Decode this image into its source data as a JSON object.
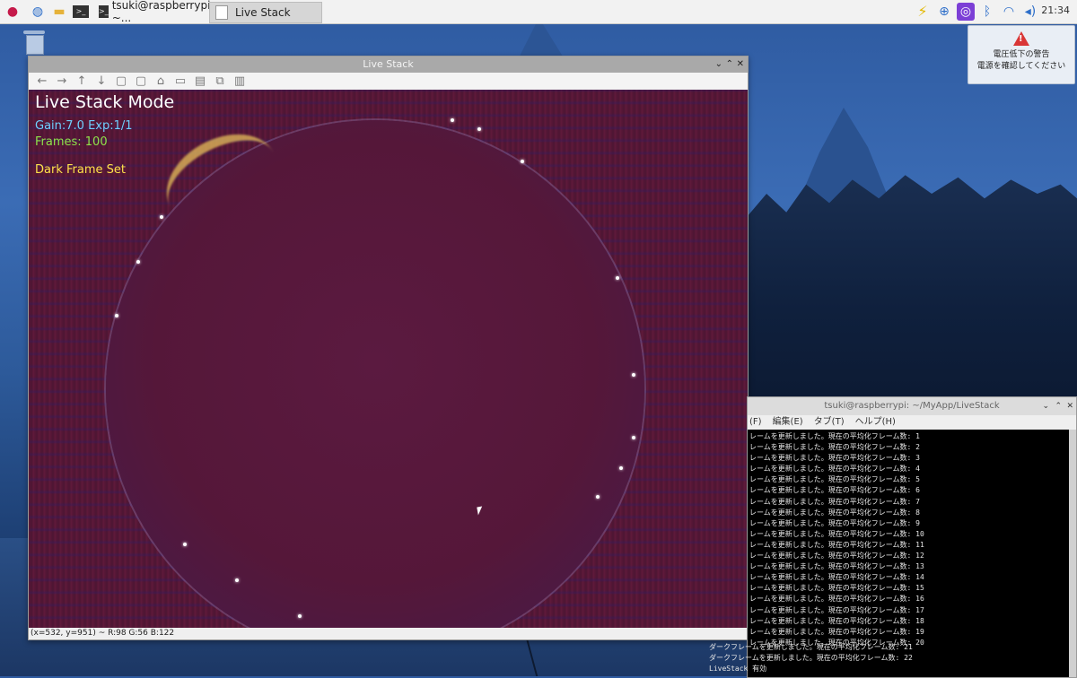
{
  "taskbar": {
    "tasks": [
      {
        "label": "tsuki@raspberrypi: ~..."
      },
      {
        "label": "Live Stack"
      }
    ],
    "clock": "21:34",
    "icons": [
      "raspberry-menu-icon",
      "browser-globe-icon",
      "file-manager-icon",
      "terminal-icon",
      "power-bolt-icon",
      "download-icon",
      "vnc-icon",
      "bluetooth-icon",
      "wifi-icon",
      "volume-icon"
    ]
  },
  "notification": {
    "line1": "電圧低下の警告",
    "line2": "電源を確認してください"
  },
  "livestack": {
    "window_title": "Live Stack",
    "overlay": {
      "mode": "Live Stack Mode",
      "gain_exp": "Gain:7.0 Exp:1/1",
      "frames": "Frames: 100",
      "dark": "Dark Frame Set"
    },
    "status": "(x=532, y=951) ~ R:98 G:56 B:122"
  },
  "terminal": {
    "title": "tsuki@raspberrypi: ~/MyApp/LiveStack",
    "menu": [
      "(F)",
      "編集(E)",
      "タブ(T)",
      "ヘルプ(H)"
    ],
    "lines": [
      "レームを更新しました。現在の平均化フレーム数: 1",
      "レームを更新しました。現在の平均化フレーム数: 2",
      "レームを更新しました。現在の平均化フレーム数: 3",
      "レームを更新しました。現在の平均化フレーム数: 4",
      "レームを更新しました。現在の平均化フレーム数: 5",
      "レームを更新しました。現在の平均化フレーム数: 6",
      "レームを更新しました。現在の平均化フレーム数: 7",
      "レームを更新しました。現在の平均化フレーム数: 8",
      "レームを更新しました。現在の平均化フレーム数: 9",
      "レームを更新しました。現在の平均化フレーム数: 10",
      "レームを更新しました。現在の平均化フレーム数: 11",
      "レームを更新しました。現在の平均化フレーム数: 12",
      "レームを更新しました。現在の平均化フレーム数: 13",
      "レームを更新しました。現在の平均化フレーム数: 14",
      "レームを更新しました。現在の平均化フレーム数: 15",
      "レームを更新しました。現在の平均化フレーム数: 16",
      "レームを更新しました。現在の平均化フレーム数: 17",
      "レームを更新しました。現在の平均化フレーム数: 18",
      "レームを更新しました。現在の平均化フレーム数: 19",
      "レームを更新しました。現在の平均化フレーム数: 20"
    ],
    "tail_lines": [
      "ダークフレームを更新しました。現在の平均化フレーム数: 21",
      "ダークフレームを更新しました。現在の平均化フレーム数: 22",
      "LiveStack 有効"
    ]
  }
}
